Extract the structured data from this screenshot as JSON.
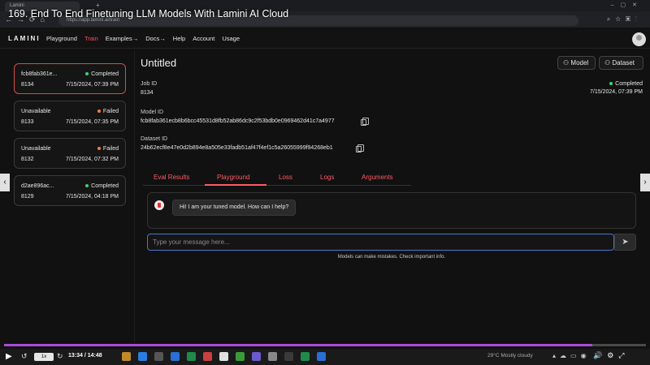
{
  "video": {
    "title": "169. End To End Finetuning LLM Models With Lamini AI Cloud",
    "speed": "1x",
    "time": "13:34 / 14:48",
    "progress_fraction": 0.916,
    "progress_color": "#a64dd8"
  },
  "browser": {
    "tab_title": "Lamini",
    "url": "https://app.lamini.ai/train"
  },
  "header": {
    "logo": "LAMINI",
    "nav": {
      "playground": "Playground",
      "train": "Train",
      "examples": "Examples→",
      "docs": "Docs→",
      "help": "Help",
      "account": "Account",
      "usage": "Usage"
    },
    "active_color": "#ff4d5e"
  },
  "jobs": [
    {
      "name": "fcb8fab361e...",
      "status": "Completed",
      "id": "8134",
      "date": "7/15/2024, 07:39 PM"
    },
    {
      "name": "Unavailable",
      "status": "Failed",
      "id": "8133",
      "date": "7/15/2024, 07:35 PM"
    },
    {
      "name": "Unavailable",
      "status": "Failed",
      "id": "8132",
      "date": "7/15/2024, 07:32 PM"
    },
    {
      "name": "d2ae896ac...",
      "status": "Completed",
      "id": "8129",
      "date": "7/15/2024, 04:18 PM"
    }
  ],
  "main": {
    "title": "Untitled",
    "model_button": "Model",
    "dataset_button": "Dataset",
    "job_id_label": "Job ID",
    "job_id": "8134",
    "status": "Completed",
    "date": "7/15/2024, 07:39 PM",
    "model_id_label": "Model ID",
    "model_id": "fcb8fab361ecb8b6bcc45531d8fb52ab86dc9c2f53bdb0e0969462d41c7a4977",
    "dataset_id_label": "Dataset ID",
    "dataset_id": "24b62ecf8e47e0d2b894e8a505e33fadb51af47f4ef1c5a26055999f94268eb1",
    "tabs": {
      "eval": "Eval Results",
      "playground": "Playground",
      "loss": "Loss",
      "logs": "Logs",
      "arguments": "Arguments"
    },
    "bot_message": "Hi! I am your tuned model. How can I help?",
    "input_placeholder": "Type your message here...",
    "disclaimer": "Models can make mistakes. Check important info."
  },
  "taskbar": {
    "weather": "29°C  Mostly cloudy"
  },
  "colors": {
    "completed": "#3ad37a",
    "failed": "#ff7a3a",
    "accent": "#ff5a66"
  }
}
